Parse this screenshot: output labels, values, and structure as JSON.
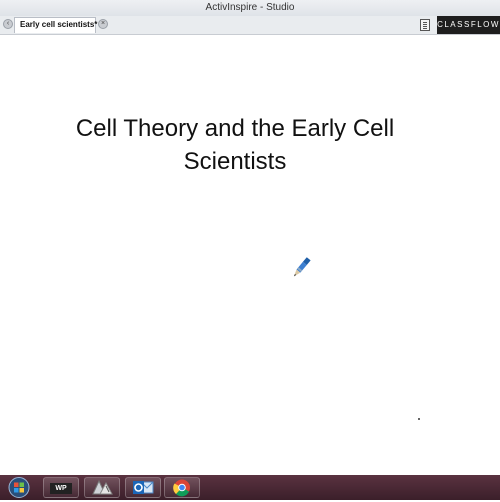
{
  "window": {
    "title": "ActivInspire - Studio"
  },
  "tabs": [
    {
      "label": "Early cell scientists*"
    }
  ],
  "brand": {
    "label": "CLASSFLOW"
  },
  "slide": {
    "title_line1": "Cell Theory and the Early Cell",
    "title_line2": "Scientists"
  },
  "taskbar": {
    "wordperfect_label": "WP"
  },
  "icons": {
    "tab_prev": "left-arrow-icon",
    "tab_close": "close-icon",
    "document": "document-icon",
    "pen": "pen-tool-icon",
    "start": "start-orb-icon",
    "outlook": "outlook-icon",
    "chrome": "chrome-icon"
  },
  "colors": {
    "taskbar": "#4a2734",
    "brand_bg": "#1e1e1e",
    "canvas": "#ffffff"
  }
}
